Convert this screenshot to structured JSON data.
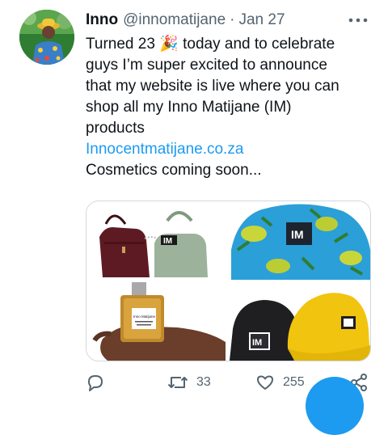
{
  "tweet": {
    "author": {
      "display_name": "Inno",
      "handle": "@innomatijane",
      "separator": "·",
      "date": "Jan 27"
    },
    "text_lines": [
      "Turned 23 🎉 today and to celebrate",
      "guys I’m super excited to announce",
      "that my website is live where you can",
      "shop all my Inno Matijane (IM)",
      "products"
    ],
    "link_text": "Innocentmatijane.co.za",
    "text_after_link": "Cosmetics coming soon...",
    "media": {
      "images": [
        {
          "name": "handbags-image",
          "brand_label": "IM"
        },
        {
          "name": "blue-bucket-hat-image",
          "brand_label": "IM"
        },
        {
          "name": "perfume-bottle-image",
          "brand_label": "Inno Matijane"
        },
        {
          "name": "bucket-hats-black-yellow-image",
          "brand_label": "IM"
        }
      ]
    },
    "actions": {
      "reply_icon": "reply-icon",
      "retweet_icon": "retweet-icon",
      "retweet_count": "33",
      "like_icon": "heart-icon",
      "like_count": "255",
      "share_icon": "share-icon"
    }
  },
  "colors": {
    "accent": "#1d9bf0",
    "secondary_text": "#536471",
    "border": "#cfd9de"
  }
}
